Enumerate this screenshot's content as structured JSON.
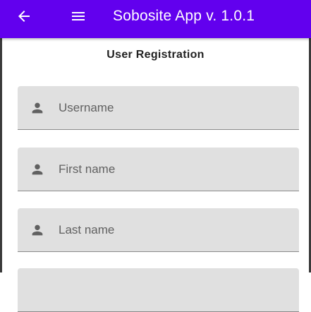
{
  "app_bar": {
    "title": "Sobosite App v. 1.0.1",
    "background_color": "#6200ee",
    "back_icon": "arrow-back-icon",
    "menu_icon": "hamburger-menu-icon"
  },
  "form": {
    "heading": "User Registration",
    "fields": [
      {
        "placeholder": "Username",
        "value": "",
        "icon": "person-icon"
      },
      {
        "placeholder": "First name",
        "value": "",
        "icon": "person-icon"
      },
      {
        "placeholder": "Last name",
        "value": "",
        "icon": "person-icon"
      }
    ]
  }
}
